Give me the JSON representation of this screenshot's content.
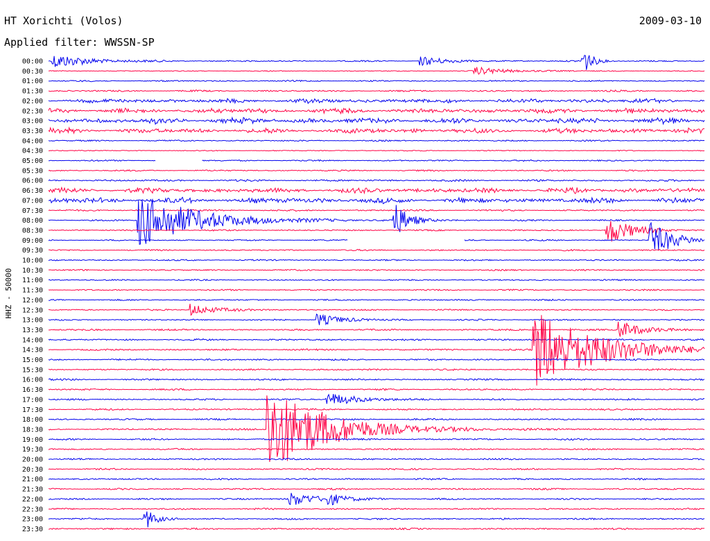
{
  "header": {
    "title": "HT Xorichti (Volos)",
    "date": "2009-03-10",
    "filter": "Applied filter: WWSSN-SP"
  },
  "chart_data": {
    "type": "line",
    "title": "HT Xorichti (Volos)",
    "subtitle": "Applied filter: WWSSN-SP",
    "ylabel": "HHZ - 50000",
    "xlabel": "",
    "colors": [
      "#0000ee",
      "#ff0044"
    ],
    "rows": [
      "00:00",
      "00:30",
      "01:00",
      "01:30",
      "02:00",
      "02:30",
      "03:00",
      "03:30",
      "04:00",
      "04:30",
      "05:00",
      "05:30",
      "06:00",
      "06:30",
      "07:00",
      "07:30",
      "08:00",
      "08:30",
      "09:00",
      "09:30",
      "10:00",
      "10:30",
      "11:00",
      "11:30",
      "12:00",
      "12:30",
      "13:00",
      "13:30",
      "14:00",
      "14:30",
      "15:00",
      "15:30",
      "16:00",
      "16:30",
      "17:00",
      "17:30",
      "18:00",
      "18:30",
      "19:00",
      "19:30",
      "20:00",
      "20:30",
      "21:00",
      "21:30",
      "22:00",
      "22:30",
      "23:00",
      "23:30"
    ],
    "row_noise_level": [
      0.3,
      0.2,
      0.3,
      0.35,
      0.8,
      0.9,
      1.0,
      0.9,
      0.3,
      0.2,
      0.3,
      0.3,
      0.4,
      0.9,
      1.0,
      0.35,
      0.3,
      0.3,
      0.3,
      0.3,
      0.3,
      0.3,
      0.3,
      0.3,
      0.3,
      0.3,
      0.3,
      0.35,
      0.35,
      0.35,
      0.35,
      0.35,
      0.35,
      0.35,
      0.35,
      0.35,
      0.35,
      0.35,
      0.35,
      0.35,
      0.35,
      0.35,
      0.35,
      0.35,
      0.35,
      0.35,
      0.35,
      0.35
    ],
    "events": [
      {
        "row": 0,
        "minute": 0.2,
        "amp": 1.2,
        "decay": 1.5
      },
      {
        "row": 0,
        "minute": 17.0,
        "amp": 0.8,
        "decay": 1.0
      },
      {
        "row": 0,
        "minute": 24.4,
        "amp": 2.5,
        "decay": 0.4
      },
      {
        "row": 1,
        "minute": 19.5,
        "amp": 0.6,
        "decay": 1.5
      },
      {
        "row": 16,
        "minute": 4.1,
        "amp": 4.5,
        "decay": 2.5
      },
      {
        "row": 16,
        "minute": 15.8,
        "amp": 3.0,
        "decay": 0.6
      },
      {
        "row": 17,
        "minute": 25.5,
        "amp": 2.5,
        "decay": 1.0
      },
      {
        "row": 18,
        "minute": 27.5,
        "amp": 3.0,
        "decay": 1.0
      },
      {
        "row": 25,
        "minute": 6.5,
        "amp": 1.0,
        "decay": 1.0
      },
      {
        "row": 26,
        "minute": 12.3,
        "amp": 1.0,
        "decay": 1.0
      },
      {
        "row": 27,
        "minute": 26.1,
        "amp": 1.5,
        "decay": 1.0
      },
      {
        "row": 29,
        "minute": 22.2,
        "amp": 6.5,
        "decay": 2.8
      },
      {
        "row": 34,
        "minute": 12.7,
        "amp": 1.2,
        "decay": 1.2
      },
      {
        "row": 37,
        "minute": 10.0,
        "amp": 7.5,
        "decay": 2.5
      },
      {
        "row": 44,
        "minute": 11.0,
        "amp": 1.2,
        "decay": 1.2
      },
      {
        "row": 44,
        "minute": 12.8,
        "amp": 1.0,
        "decay": 0.5
      },
      {
        "row": 46,
        "minute": 4.4,
        "amp": 2.0,
        "decay": 0.4
      }
    ],
    "gaps": [
      {
        "row": 10,
        "from_minute": 4.9,
        "to_minute": 7.0
      },
      {
        "row": 18,
        "from_minute": 13.7,
        "to_minute": 19.0
      }
    ]
  }
}
